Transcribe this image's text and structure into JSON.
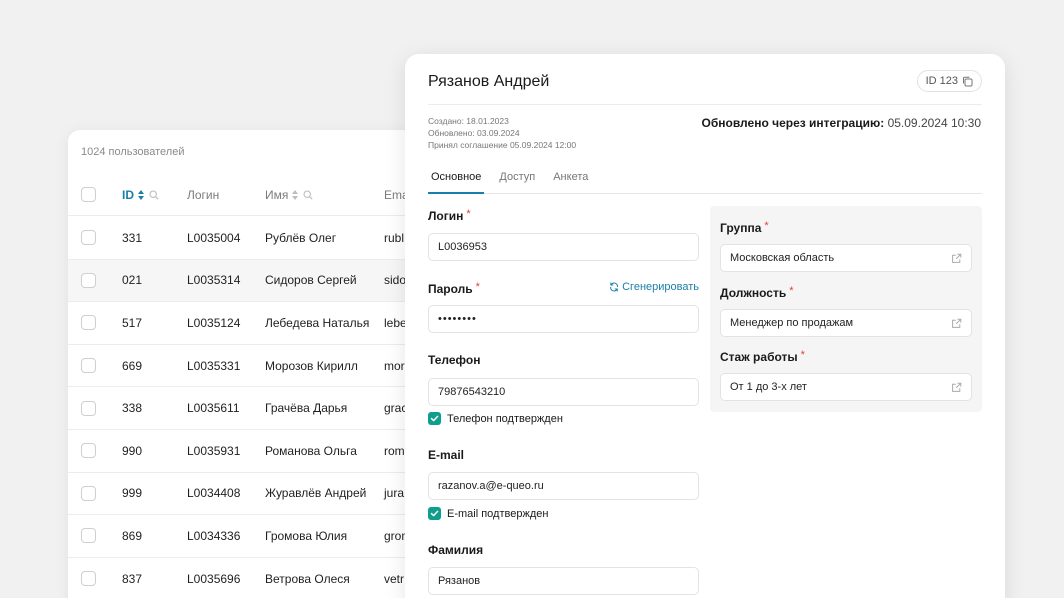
{
  "table": {
    "count_label": "1024 пользователей",
    "columns": {
      "id": "ID",
      "login": "Логин",
      "name": "Имя",
      "email": "Ema"
    },
    "rows": [
      {
        "id": "331",
        "login": "L0035004",
        "name": "Рублёв Олег",
        "email": "rubl"
      },
      {
        "id": "021",
        "login": "L0035314",
        "name": "Сидоров Сергей",
        "email": "sido"
      },
      {
        "id": "517",
        "login": "L0035124",
        "name": "Лебедева Наталья",
        "email": "lebe"
      },
      {
        "id": "669",
        "login": "L0035331",
        "name": "Морозов Кирилл",
        "email": "mor"
      },
      {
        "id": "338",
        "login": "L0035611",
        "name": "Грачёва Дарья",
        "email": "grac"
      },
      {
        "id": "990",
        "login": "L0035931",
        "name": "Романова Ольга",
        "email": "rom"
      },
      {
        "id": "999",
        "login": "L0034408",
        "name": "Журавлёв Андрей",
        "email": "jura"
      },
      {
        "id": "869",
        "login": "L0034336",
        "name": "Громова Юлия",
        "email": "gron"
      },
      {
        "id": "837",
        "login": "L0035696",
        "name": "Ветрова Олеся",
        "email": "vetr"
      }
    ]
  },
  "card": {
    "title": "Рязанов Андрей",
    "id_chip": "ID 123",
    "meta": {
      "created": "Создано: 18.01.2023",
      "updated": "Обновлено: 03.09.2024",
      "agreement": "Принял соглашение 05.09.2024 12:00"
    },
    "integration": {
      "label": "Обновлено через интеграцию:",
      "value": "05.09.2024 10:30"
    },
    "tabs": [
      "Основное",
      "Доступ",
      "Анкета"
    ],
    "form": {
      "login": {
        "label": "Логин",
        "required": "*",
        "value": "L0036953"
      },
      "password": {
        "label": "Пароль",
        "required": "*",
        "value": "••••••••",
        "generate": "Сгенерировать"
      },
      "phone": {
        "label": "Телефон",
        "value": "79876543210",
        "confirmed": "Телефон подтвержден"
      },
      "email": {
        "label": "E-mail",
        "value": "razanov.a@e-queo.ru",
        "confirmed": "E-mail подтвержден"
      },
      "surname": {
        "label": "Фамилия",
        "value": "Рязанов"
      }
    },
    "side": {
      "group": {
        "label": "Группа",
        "required": "*",
        "value": "Московская область"
      },
      "position": {
        "label": "Должность",
        "required": "*",
        "value": "Менеджер по продажам"
      },
      "experience": {
        "label": "Стаж работы",
        "required": "*",
        "value": "От 1 до 3-х лет"
      }
    }
  },
  "colors": {
    "accent": "#1a7fa8",
    "check": "#0d9e8e",
    "required": "#e0403a"
  }
}
